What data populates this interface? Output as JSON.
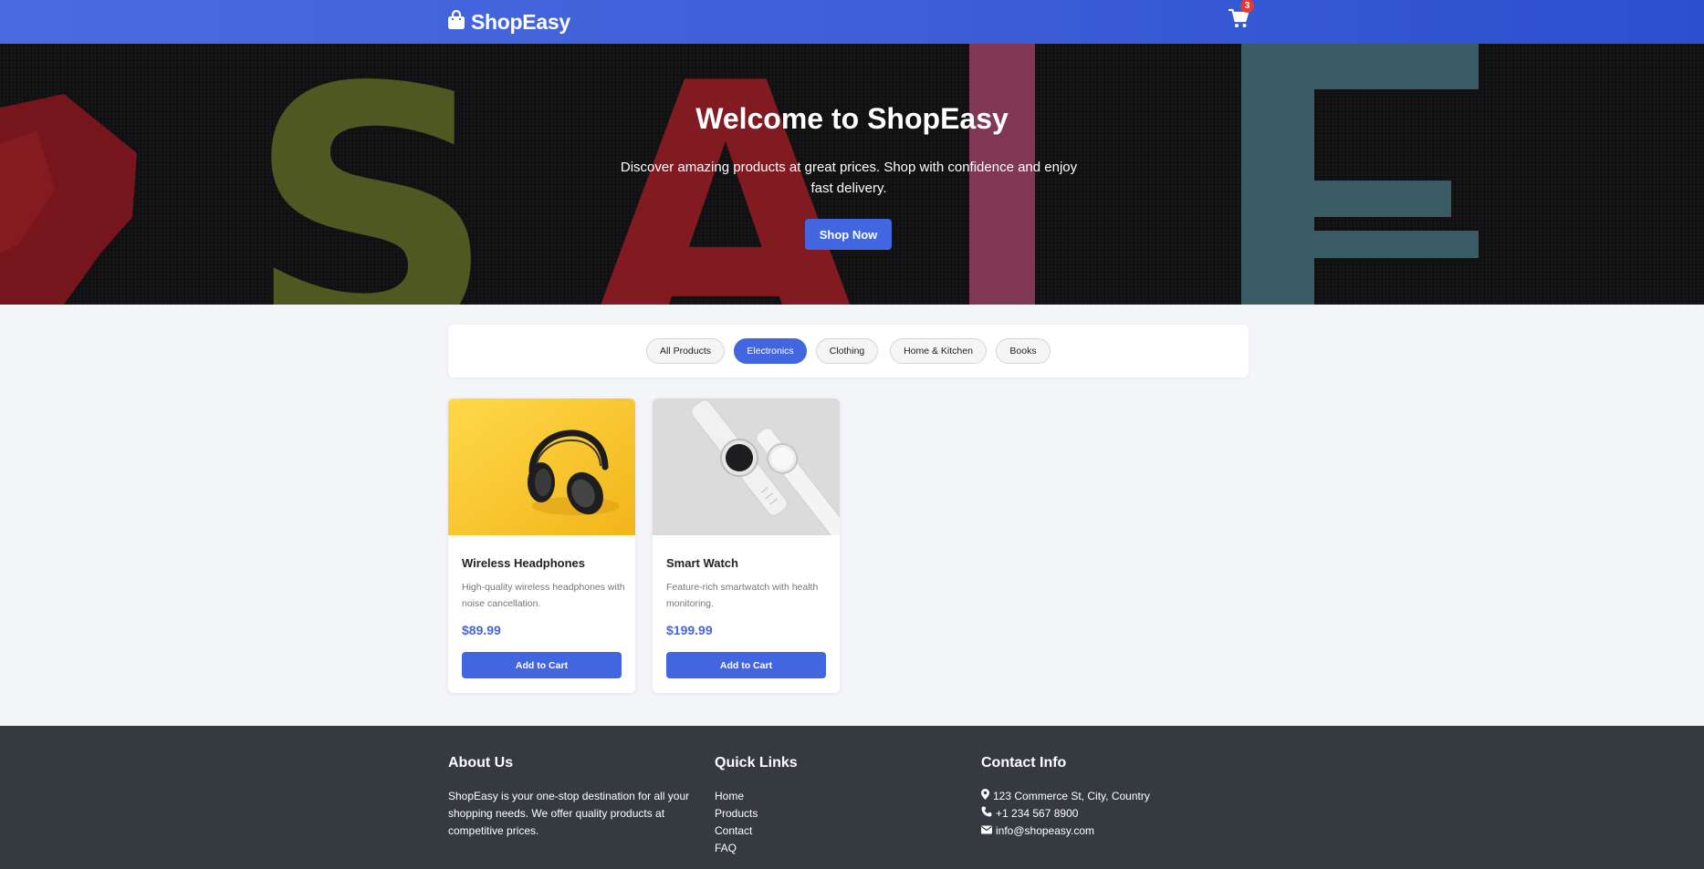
{
  "header": {
    "brand": "ShopEasy",
    "cart_count": "3"
  },
  "hero": {
    "title": "Welcome to ShopEasy",
    "subtitle": "Discover amazing products at great prices. Shop with confidence and enjoy fast delivery.",
    "cta_label": "Shop Now",
    "background_letters": [
      "S",
      "A",
      "L",
      "E"
    ]
  },
  "filters": {
    "categories": [
      {
        "label": "All Products",
        "active": false
      },
      {
        "label": "Electronics",
        "active": true
      },
      {
        "label": "Clothing",
        "active": false
      },
      {
        "label": "Home & Kitchen",
        "active": false
      },
      {
        "label": "Books",
        "active": false
      }
    ]
  },
  "products": [
    {
      "name": "Wireless Headphones",
      "description": "High-quality wireless headphones with noise cancellation.",
      "price": "$89.99",
      "button_label": "Add to Cart"
    },
    {
      "name": "Smart Watch",
      "description": "Feature-rich smartwatch with health monitoring.",
      "price": "$199.99",
      "button_label": "Add to Cart"
    }
  ],
  "footer": {
    "about": {
      "title": "About Us",
      "text": "ShopEasy is your one-stop destination for all your shopping needs. We offer quality products at competitive prices."
    },
    "links": {
      "title": "Quick Links",
      "items": [
        "Home",
        "Products",
        "Contact",
        "FAQ"
      ]
    },
    "contact": {
      "title": "Contact Info",
      "address": "123 Commerce St, City, Country",
      "phone": "+1 234 567 8900",
      "email": "info@shopeasy.com"
    }
  },
  "colors": {
    "primary": "#4266df",
    "header_gradient_start": "#4a6be0",
    "header_gradient_end": "#2c4fd0",
    "footer_bg": "#343a40",
    "badge": "#e53935",
    "page_bg": "#f4f5f9"
  },
  "icons": {
    "brand": "shopping-bag-icon",
    "cart": "shopping-cart-icon",
    "address": "map-marker-icon",
    "phone": "phone-icon",
    "email": "envelope-icon"
  }
}
